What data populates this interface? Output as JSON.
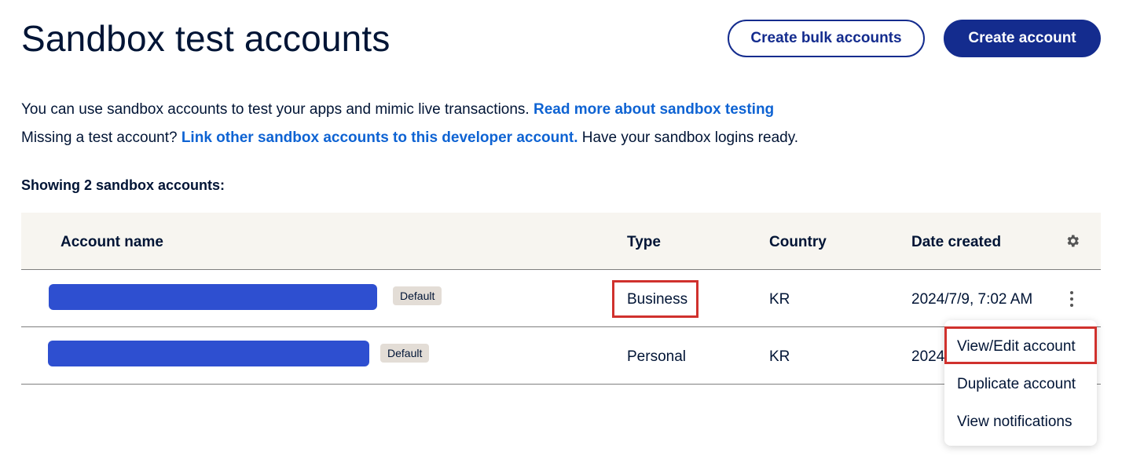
{
  "header": {
    "title": "Sandbox test accounts",
    "bulk_button": "Create bulk accounts",
    "create_button": "Create account"
  },
  "intro": {
    "line1_text": "You can use sandbox accounts to test your apps and mimic live transactions.",
    "line1_link": "Read more about sandbox testing",
    "line2_prefix": "Missing a test account?",
    "line2_link": "Link other sandbox accounts to this developer account.",
    "line2_suffix": "Have your sandbox logins ready."
  },
  "showing": "Showing 2 sandbox accounts:",
  "table": {
    "columns": [
      "Account name",
      "Type",
      "Country",
      "Date created"
    ],
    "rows": [
      {
        "badge": "Default",
        "type": "Business",
        "country": "KR",
        "date": "2024/7/9, 7:02 AM"
      },
      {
        "badge": "Default",
        "type": "Personal",
        "country": "KR",
        "date": "2024"
      }
    ]
  },
  "menu": {
    "items": [
      "View/Edit account",
      "Duplicate account",
      "View notifications"
    ]
  },
  "colors": {
    "primary": "#142c8e",
    "link": "#0e63d3",
    "redacted_name": "#2e4fd0",
    "highlight": "#d0312d",
    "header_bg": "#f7f5f0"
  },
  "icons": [
    "gear-icon",
    "kebab-menu-icon"
  ]
}
